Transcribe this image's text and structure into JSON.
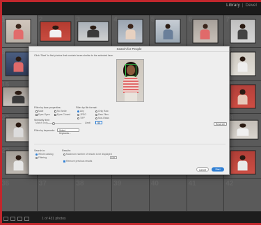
{
  "app": {
    "brand": "Library",
    "brand_next": "Devel"
  },
  "grid": {
    "cells": [
      {
        "selected": true,
        "bg": "#b9b0a6",
        "top": "#d1c6bd",
        "skin": "#3a241a",
        "shirt": "#e26b6b",
        "portrait": true
      },
      {
        "selected": false,
        "bg": "#c94c40",
        "top": "#b33b30",
        "skin": "#2a1a12",
        "shirt": "#f1f1f1",
        "portrait": false
      },
      {
        "selected": false,
        "bg": "#cfd0d0",
        "top": "#a9b0b8",
        "skin": "#2b1c14",
        "shirt": "#3a3a3a",
        "portrait": false
      },
      {
        "selected": false,
        "bg": "#c1c7cf",
        "top": "#9aa5b1",
        "skin": "#3a241a",
        "shirt": "#e7d1c0",
        "portrait": true
      },
      {
        "selected": false,
        "bg": "#9aa7b3",
        "top": "#c7cdd4",
        "skin": "#2b1c14",
        "shirt": "#6a7f9a",
        "portrait": true
      },
      {
        "selected": false,
        "bg": "#c7c0b8",
        "top": "#a7a09a",
        "skin": "#3a241a",
        "shirt": "#e06a6a",
        "portrait": true
      },
      {
        "selected": false,
        "bg": "#d6d6d6",
        "top": "#bfbfbf",
        "skin": "#2a1a12",
        "shirt": "#444444",
        "portrait": true
      },
      {
        "selected": true,
        "bg": "#2f3b58",
        "top": "#4b5d80",
        "skin": "#2a1a12",
        "shirt": "#e06a6a",
        "portrait": true
      },
      {
        "selected": false,
        "bg": "#5a5a5a",
        "top": "#5a5a5a",
        "skin": "#5a5a5a",
        "shirt": "#5a5a5a",
        "portrait": false,
        "empty": true
      },
      {
        "selected": false,
        "bg": "#5a5a5a",
        "top": "#5a5a5a",
        "skin": "#5a5a5a",
        "shirt": "#5a5a5a",
        "portrait": false,
        "empty": true
      },
      {
        "selected": false,
        "bg": "#5a5a5a",
        "top": "#5a5a5a",
        "skin": "#5a5a5a",
        "shirt": "#5a5a5a",
        "portrait": false,
        "empty": true
      },
      {
        "selected": false,
        "bg": "#5a5a5a",
        "top": "#5a5a5a",
        "skin": "#5a5a5a",
        "shirt": "#5a5a5a",
        "portrait": false,
        "empty": true
      },
      {
        "selected": false,
        "bg": "#5a5a5a",
        "top": "#5a5a5a",
        "skin": "#5a5a5a",
        "shirt": "#5a5a5a",
        "portrait": false,
        "empty": true
      },
      {
        "selected": false,
        "bg": "#e2dfd8",
        "top": "#cfcac2",
        "skin": "#2a1a12",
        "shirt": "#eeeeee",
        "portrait": true
      },
      {
        "selected": false,
        "bg": "#c6c1bb",
        "top": "#9f9891",
        "skin": "#2a1a12",
        "shirt": "#3a3a3a",
        "portrait": false
      },
      {
        "selected": false,
        "bg": "#5a5a5a",
        "top": "#5a5a5a",
        "skin": "#5a5a5a",
        "shirt": "#5a5a5a",
        "portrait": false,
        "empty": true
      },
      {
        "selected": false,
        "bg": "#5a5a5a",
        "top": "#5a5a5a",
        "skin": "#5a5a5a",
        "shirt": "#5a5a5a",
        "portrait": false,
        "empty": true
      },
      {
        "selected": false,
        "bg": "#5a5a5a",
        "top": "#5a5a5a",
        "skin": "#5a5a5a",
        "shirt": "#5a5a5a",
        "portrait": false,
        "empty": true
      },
      {
        "selected": false,
        "bg": "#5a5a5a",
        "top": "#5a5a5a",
        "skin": "#5a5a5a",
        "shirt": "#5a5a5a",
        "portrait": false,
        "empty": true
      },
      {
        "selected": false,
        "bg": "#5a5a5a",
        "top": "#5a5a5a",
        "skin": "#5a5a5a",
        "shirt": "#5a5a5a",
        "portrait": false,
        "empty": true
      },
      {
        "selected": false,
        "bg": "#cf4d43",
        "top": "#b3403a",
        "skin": "#2a1a12",
        "shirt": "#e7c7b8",
        "portrait": true
      },
      {
        "selected": false,
        "bg": "#c9c4be",
        "top": "#b0aaa2",
        "skin": "#2a1a12",
        "shirt": "#dcdcdc",
        "portrait": true
      },
      {
        "selected": false,
        "bg": "#5a5a5a",
        "top": "#5a5a5a",
        "skin": "#5a5a5a",
        "shirt": "#5a5a5a",
        "portrait": false,
        "empty": true
      },
      {
        "selected": false,
        "bg": "#5a5a5a",
        "top": "#5a5a5a",
        "skin": "#5a5a5a",
        "shirt": "#5a5a5a",
        "portrait": false,
        "empty": true
      },
      {
        "selected": false,
        "bg": "#5a5a5a",
        "top": "#5a5a5a",
        "skin": "#5a5a5a",
        "shirt": "#5a5a5a",
        "portrait": false,
        "empty": true
      },
      {
        "selected": false,
        "bg": "#5a5a5a",
        "top": "#5a5a5a",
        "skin": "#5a5a5a",
        "shirt": "#5a5a5a",
        "portrait": false,
        "empty": true
      },
      {
        "selected": false,
        "bg": "#5a5a5a",
        "top": "#5a5a5a",
        "skin": "#5a5a5a",
        "shirt": "#5a5a5a",
        "portrait": false,
        "empty": true
      },
      {
        "selected": false,
        "bg": "#d9d5cf",
        "top": "#c3bdb6",
        "skin": "#2a1a12",
        "shirt": "#f0f0f0",
        "portrait": false
      },
      {
        "selected": false,
        "bg": "#bfb9b2",
        "top": "#a49e97",
        "skin": "#2a1a12",
        "shirt": "#e7e7e7",
        "portrait": true
      },
      {
        "selected": false,
        "bg": "#b4aea7",
        "top": "#8f8a84",
        "skin": "#3a241a",
        "shirt": "#2f3b58",
        "portrait": true
      },
      {
        "selected": false,
        "bg": "#c44c42",
        "top": "#a53d35",
        "skin": "#2a1a12",
        "shirt": "#e7d3c6",
        "portrait": true
      },
      {
        "selected": false,
        "bg": "#d2cec8",
        "top": "#bbb5ae",
        "skin": "#2a1a12",
        "shirt": "#e7e7e7",
        "portrait": true
      },
      {
        "selected": false,
        "bg": "#bdb7b0",
        "top": "#a7a19a",
        "skin": "#2a1a12",
        "shirt": "#e06a6a",
        "portrait": true
      },
      {
        "selected": false,
        "bg": "#d8d4cd",
        "top": "#c2bdb5",
        "skin": "#2a1a12",
        "shirt": "#eeeeee",
        "portrait": true
      },
      {
        "selected": false,
        "bg": "#cc4f45",
        "top": "#b23f37",
        "skin": "#2a1a12",
        "shirt": "#e9e9e9",
        "portrait": true
      },
      {
        "selected": false,
        "bg": "#5a5a5a",
        "top": "#5a5a5a",
        "skin": "#5a5a5a",
        "shirt": "#5a5a5a",
        "portrait": false,
        "empty": true
      },
      {
        "selected": false,
        "bg": "#5a5a5a",
        "top": "#5a5a5a",
        "skin": "#5a5a5a",
        "shirt": "#5a5a5a",
        "portrait": false,
        "empty": true
      },
      {
        "selected": false,
        "bg": "#5a5a5a",
        "top": "#5a5a5a",
        "skin": "#5a5a5a",
        "shirt": "#5a5a5a",
        "portrait": false,
        "empty": true
      },
      {
        "selected": false,
        "bg": "#5a5a5a",
        "top": "#5a5a5a",
        "skin": "#5a5a5a",
        "shirt": "#5a5a5a",
        "portrait": false,
        "empty": true
      },
      {
        "selected": false,
        "bg": "#5a5a5a",
        "top": "#5a5a5a",
        "skin": "#5a5a5a",
        "shirt": "#5a5a5a",
        "portrait": false,
        "empty": true
      },
      {
        "selected": false,
        "bg": "#5a5a5a",
        "top": "#5a5a5a",
        "skin": "#5a5a5a",
        "shirt": "#5a5a5a",
        "portrait": false,
        "empty": true
      },
      {
        "selected": false,
        "bg": "#5a5a5a",
        "top": "#5a5a5a",
        "skin": "#5a5a5a",
        "shirt": "#5a5a5a",
        "portrait": false,
        "empty": true
      }
    ]
  },
  "dialog": {
    "title": "Search for People",
    "description": "Click 'Start' to find photos that contain faces similar to the selected face.",
    "filter_face_props": "Filter by face properties:",
    "face_opts": [
      "Male",
      "No Smile",
      "Eyes Open",
      "Eyes Closed"
    ],
    "filter_file_format": "Filter by file format:",
    "format_opts": [
      "Any",
      "Only Raw",
      "JPEG",
      "Raw Files",
      "TIFF",
      "Non-Raws"
    ],
    "similarity_label": "Similarity limit",
    "similarity_sub": "Match only",
    "limit_label": "Limit",
    "limit_value": "50",
    "reset_label": "Reset All",
    "filter_keywords": "Filter by keywords:",
    "keywords_button": "Select Keywords...",
    "search_in": "Search in:",
    "search_opts": [
      "Whole catalog",
      "Filtering"
    ],
    "results_label": "Results:",
    "results_opts": [
      "Maximum number of results to be displayed",
      "Remove previous results"
    ],
    "results_value": "100",
    "cancel": "Cancel",
    "start": "Start"
  },
  "status": {
    "text": "1 of 431 photos"
  }
}
